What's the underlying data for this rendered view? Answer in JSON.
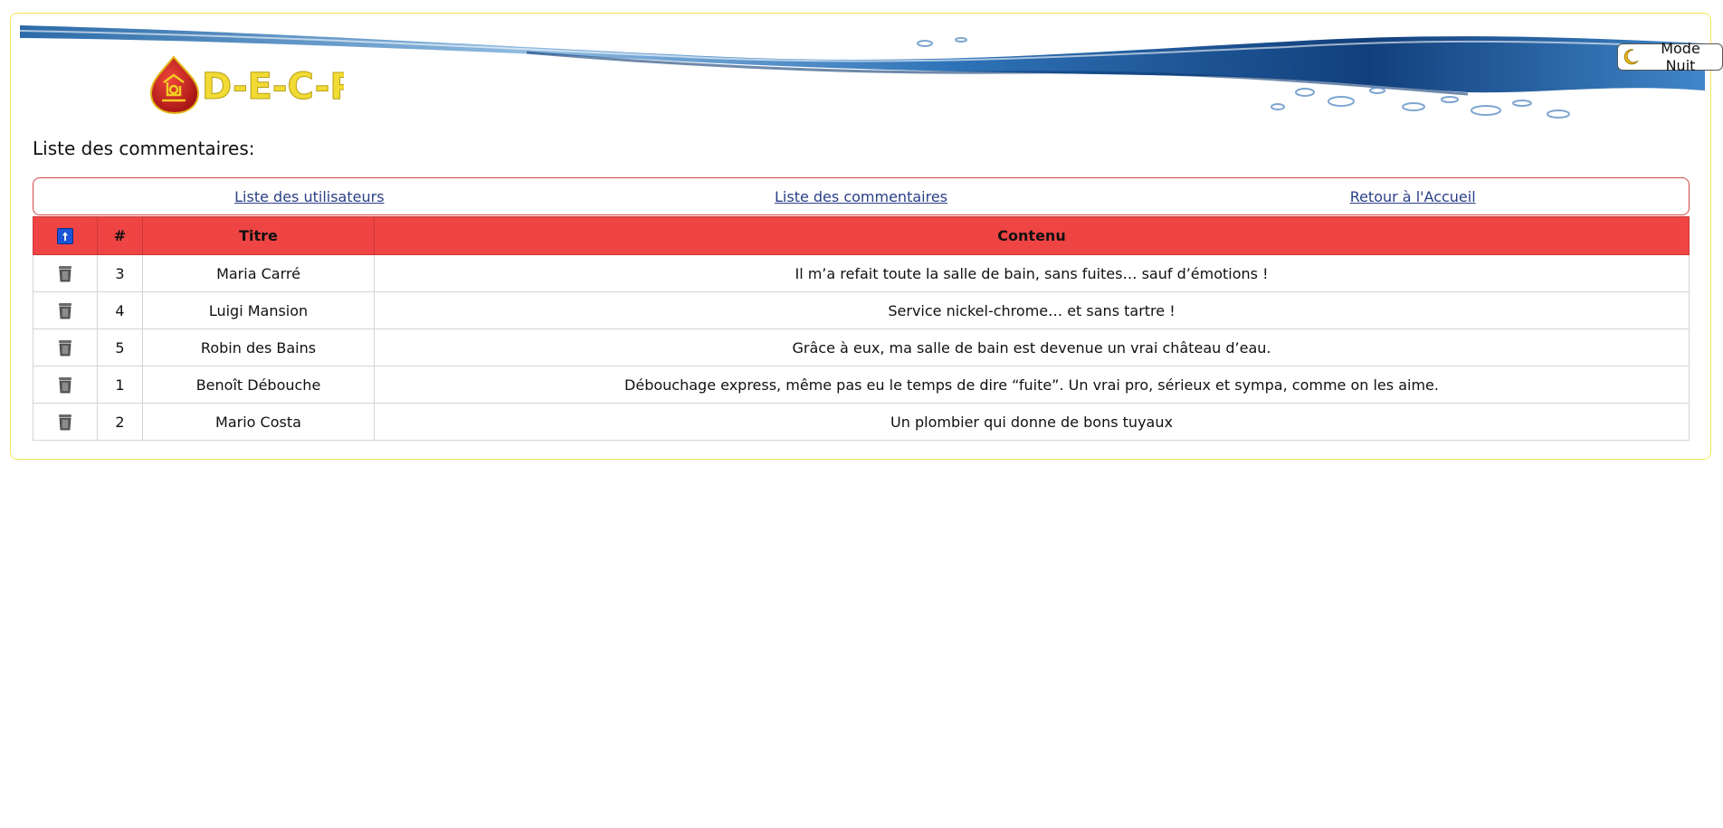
{
  "header": {
    "logo_text": "D-E-C-P",
    "night_mode_label": "Mode Nuit"
  },
  "page": {
    "title": "Liste des commentaires:"
  },
  "nav": {
    "users_link": "Liste des utilisateurs",
    "comments_link": "Liste des commentaires",
    "home_link": "Retour à l'Accueil"
  },
  "table": {
    "headers": {
      "id": "#",
      "title": "Titre",
      "content": "Contenu"
    },
    "rows": [
      {
        "id": "3",
        "titre": "Maria Carré",
        "contenu": "Il m’a refait toute la salle de bain, sans fuites… sauf d’émotions !"
      },
      {
        "id": "4",
        "titre": "Luigi Mansion",
        "contenu": "Service nickel-chrome… et sans tartre !"
      },
      {
        "id": "5",
        "titre": "Robin des Bains",
        "contenu": "Grâce à eux, ma salle de bain est devenue un vrai château d’eau."
      },
      {
        "id": "1",
        "titre": "Benoît Débouche",
        "contenu": "Débouchage express, même pas eu le temps de dire “fuite”. Un vrai pro, sérieux et sympa, comme on les aime."
      },
      {
        "id": "2",
        "titre": "Mario Costa",
        "contenu": "Un plombier qui donne de bons tuyaux"
      }
    ]
  },
  "colors": {
    "header_row": "#ef4444",
    "nav_border": "#d64747",
    "frame_border": "#f3e75a",
    "link": "#2a3f86"
  },
  "icons": {
    "sort": "sort-up-arrow-icon",
    "delete": "trash-icon",
    "night": "crescent-moon-icon"
  }
}
